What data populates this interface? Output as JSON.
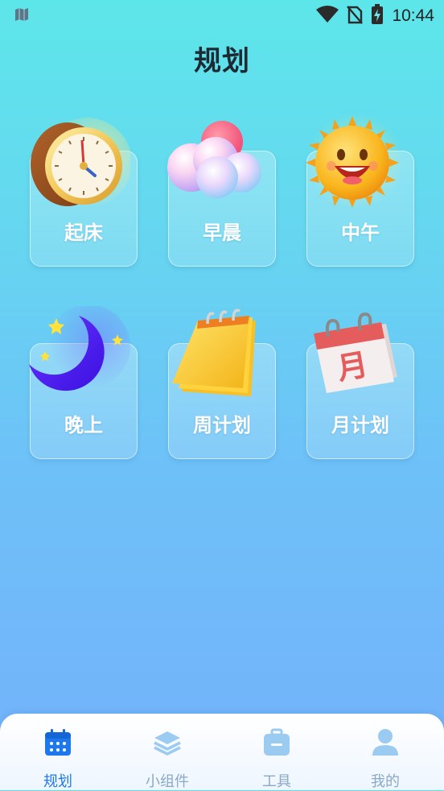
{
  "status_bar": {
    "time": "10:44",
    "icons": [
      "sim-card-icon",
      "wifi-icon",
      "no-sim-icon",
      "battery-charging-icon"
    ]
  },
  "page": {
    "title": "规划"
  },
  "cards": [
    {
      "label": "起床",
      "icon": "alarm-clock-icon"
    },
    {
      "label": "早晨",
      "icon": "cloud-icon"
    },
    {
      "label": "中午",
      "icon": "sun-icon"
    },
    {
      "label": "晚上",
      "icon": "moon-icon"
    },
    {
      "label": "周计划",
      "icon": "notepad-icon"
    },
    {
      "label": "月计划",
      "icon": "calendar-icon",
      "icon_text": "月"
    }
  ],
  "tabs": [
    {
      "label": "规划",
      "icon": "calendar-grid-icon",
      "active": true
    },
    {
      "label": "小组件",
      "icon": "layers-icon",
      "active": false
    },
    {
      "label": "工具",
      "icon": "toolbox-icon",
      "active": false
    },
    {
      "label": "我的",
      "icon": "user-icon",
      "active": false
    }
  ],
  "colors": {
    "active_tab": "#1d78ee",
    "inactive_tab": "#8aa8c8",
    "card_label": "#ffffff"
  }
}
